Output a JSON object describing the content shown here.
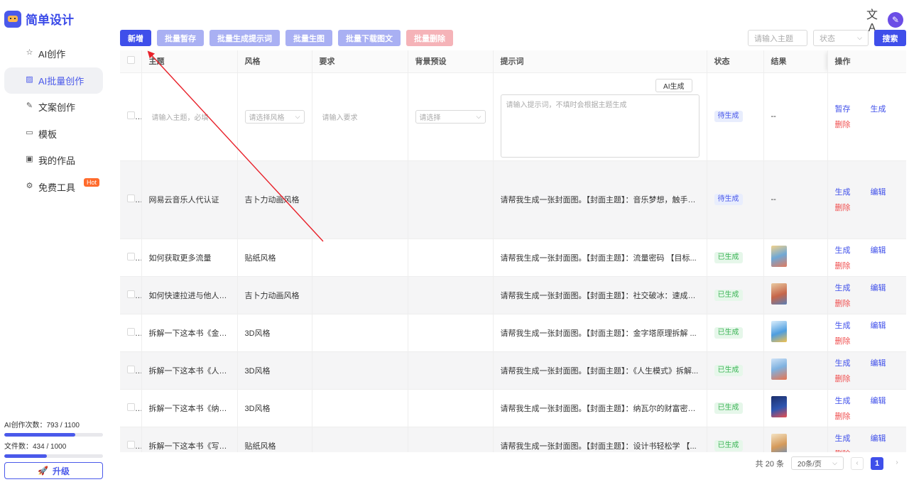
{
  "sidebar": {
    "logo": "简单设计",
    "items": [
      {
        "label": "AI创作",
        "icon": "star-icon"
      },
      {
        "label": "AI批量创作",
        "icon": "image-icon"
      },
      {
        "label": "文案创作",
        "icon": "edit-icon"
      },
      {
        "label": "模板",
        "icon": "template-icon"
      },
      {
        "label": "我的作品",
        "icon": "folder-icon"
      },
      {
        "label": "免费工具",
        "icon": "gear-icon"
      }
    ],
    "hot_badge": "Hot",
    "quota_ai": "AI创作次数：793 / 1100",
    "quota_ai_progress": 0.72,
    "quota_files": "文件数：434 / 1000",
    "quota_files_progress": 0.434,
    "upgrade": "升级"
  },
  "toolbar": {
    "new": "新增",
    "batch_save": "批量暂存",
    "batch_prompt": "批量生成提示词",
    "batch_image": "批量生图",
    "batch_download": "批量下载图文",
    "batch_delete": "批量删除"
  },
  "search": {
    "topic_placeholder": "请输入主题",
    "status_placeholder": "状态",
    "button": "搜索"
  },
  "table": {
    "headers": [
      "主题",
      "风格",
      "要求",
      "背景预设",
      "提示词",
      "状态",
      "结果",
      "操作"
    ],
    "new_row": {
      "topic_placeholder": "请输入主题，必填",
      "style_placeholder": "请选择风格",
      "req_placeholder": "请输入要求",
      "bg_placeholder": "请选择",
      "prompt_placeholder": "请输入提示词，不填时会根据主题生成",
      "ai_button": "AI生成",
      "status": "待生成",
      "result": "--",
      "op1": "暂存",
      "op2": "生成",
      "op3": "删除"
    },
    "rows": [
      {
        "topic": "网易云音乐人代认证",
        "style": "吉卜力动画风格",
        "prompt": "请帮我生成一张封面图。【封面主题】：音乐梦想，触手可...",
        "status": "待生成",
        "result": "--",
        "op1": "生成",
        "op2": "编辑",
        "op3": "删除"
      },
      {
        "topic": "如何获取更多流量",
        "style": "贴纸风格",
        "prompt": "请帮我生成一张封面图。【封面主题】：流量密码 【目标...",
        "status": "已生成",
        "op1": "生成",
        "op2": "编辑",
        "op3": "删除"
      },
      {
        "topic": "如何快速拉进与他人的...",
        "style": "吉卜力动画风格",
        "prompt": "请帮我生成一张封面图。【封面主题】：社交破冰：速成指...",
        "status": "已生成",
        "op1": "生成",
        "op2": "编辑",
        "op3": "删除"
      },
      {
        "topic": "拆解一下这本书《金字...",
        "style": "3D风格",
        "prompt": "请帮我生成一张封面图。【封面主题】：金字塔原理拆解 ...",
        "status": "已生成",
        "op1": "生成",
        "op2": "编辑",
        "op3": "删除"
      },
      {
        "topic": "拆解一下这本书《人生...",
        "style": "3D风格",
        "prompt": "请帮我生成一张封面图。【封面主题】：《人生模式》拆解...",
        "status": "已生成",
        "op1": "生成",
        "op2": "编辑",
        "op3": "删除"
      },
      {
        "topic": "拆解一下这本书《纳瓦...",
        "style": "3D风格",
        "prompt": "请帮我生成一张封面图。【封面主题】：纳瓦尔的财富密码...",
        "status": "已生成",
        "op1": "生成",
        "op2": "编辑",
        "op3": "删除"
      },
      {
        "topic": "拆解一下这本书《写给...",
        "style": "贴纸风格",
        "prompt": "请帮我生成一张封面图。【封面主题】：设计书轻松学 【...",
        "status": "已生成",
        "op1": "生成",
        "op2": "编辑",
        "op3": "删除"
      }
    ]
  },
  "pagination": {
    "total": "共 20 条",
    "page_size": "20条/页",
    "current": "1"
  },
  "colors": {
    "primary": "#3f4fea",
    "danger": "#f05050",
    "success": "#3db557",
    "annotation": "#e8212a"
  }
}
